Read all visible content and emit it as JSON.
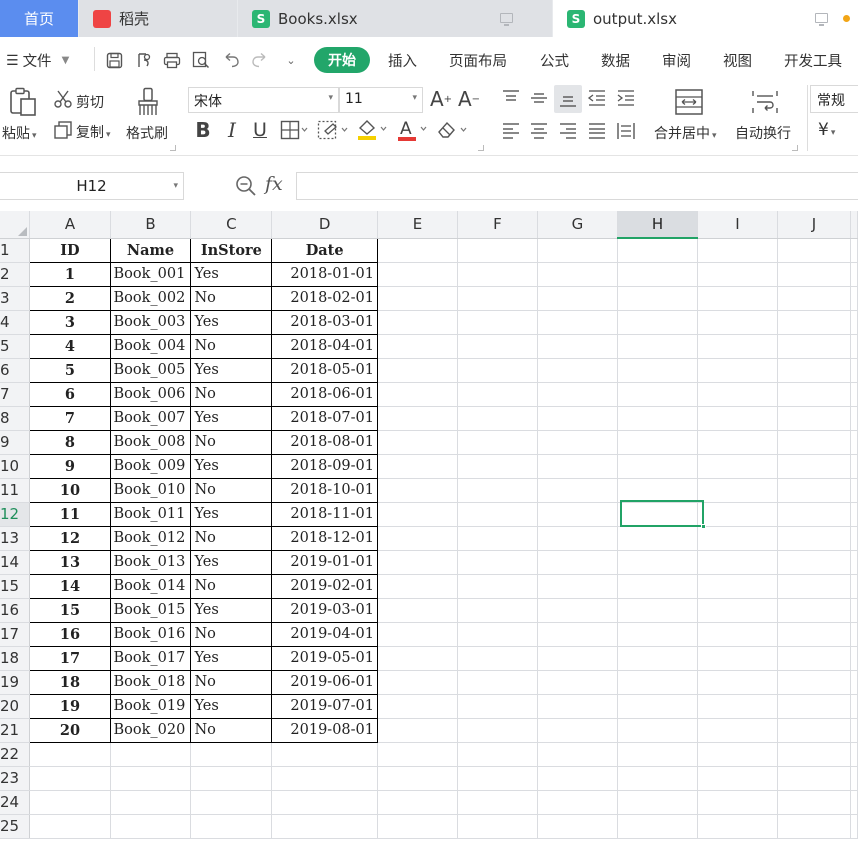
{
  "tabs": {
    "home": "首页",
    "daoke": "稻壳",
    "books": "Books.xlsx",
    "output": "output.xlsx"
  },
  "menu": {
    "file": "文件",
    "items": [
      "开始",
      "插入",
      "页面布局",
      "公式",
      "数据",
      "审阅",
      "视图",
      "开发工具"
    ]
  },
  "ribbon": {
    "paste": "粘贴",
    "cut": "剪切",
    "copy": "复制",
    "format_painter": "格式刷",
    "font_name": "宋体",
    "font_size": "11",
    "merge_center": "合并居中",
    "wrap_text": "自动换行",
    "number_format": "常规",
    "currency_symbol": "¥"
  },
  "formula_bar": {
    "cell_ref": "H12",
    "fx": "fx",
    "content": ""
  },
  "sheet": {
    "columns": [
      "A",
      "B",
      "C",
      "D",
      "E",
      "F",
      "G",
      "H",
      "I",
      "J"
    ],
    "selected_column": "H",
    "selected_row": 12,
    "row_count": 25,
    "headers": [
      "ID",
      "Name",
      "InStore",
      "Date"
    ],
    "rows": [
      [
        "1",
        "Book_001",
        "Yes",
        "2018-01-01"
      ],
      [
        "2",
        "Book_002",
        "No",
        "2018-02-01"
      ],
      [
        "3",
        "Book_003",
        "Yes",
        "2018-03-01"
      ],
      [
        "4",
        "Book_004",
        "No",
        "2018-04-01"
      ],
      [
        "5",
        "Book_005",
        "Yes",
        "2018-05-01"
      ],
      [
        "6",
        "Book_006",
        "No",
        "2018-06-01"
      ],
      [
        "7",
        "Book_007",
        "Yes",
        "2018-07-01"
      ],
      [
        "8",
        "Book_008",
        "No",
        "2018-08-01"
      ],
      [
        "9",
        "Book_009",
        "Yes",
        "2018-09-01"
      ],
      [
        "10",
        "Book_010",
        "No",
        "2018-10-01"
      ],
      [
        "11",
        "Book_011",
        "Yes",
        "2018-11-01"
      ],
      [
        "12",
        "Book_012",
        "No",
        "2018-12-01"
      ],
      [
        "13",
        "Book_013",
        "Yes",
        "2019-01-01"
      ],
      [
        "14",
        "Book_014",
        "No",
        "2019-02-01"
      ],
      [
        "15",
        "Book_015",
        "Yes",
        "2019-03-01"
      ],
      [
        "16",
        "Book_016",
        "No",
        "2019-04-01"
      ],
      [
        "17",
        "Book_017",
        "Yes",
        "2019-05-01"
      ],
      [
        "18",
        "Book_018",
        "No",
        "2019-06-01"
      ],
      [
        "19",
        "Book_019",
        "Yes",
        "2019-07-01"
      ],
      [
        "20",
        "Book_020",
        "No",
        "2019-08-01"
      ]
    ]
  },
  "colors": {
    "accent_green": "#22a66a",
    "home_tab": "#5b8def",
    "selection": "#21a366"
  }
}
